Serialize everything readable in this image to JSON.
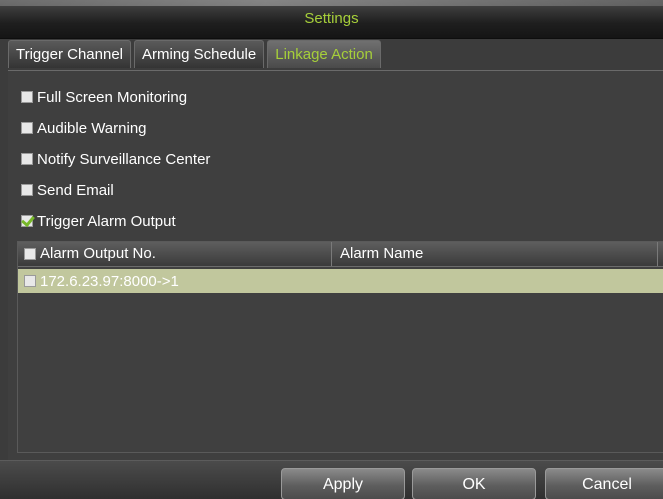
{
  "dialog": {
    "title": "Settings"
  },
  "tabs": [
    {
      "label": "Trigger Channel",
      "active": false
    },
    {
      "label": "Arming Schedule",
      "active": false
    },
    {
      "label": "Linkage Action",
      "active": true
    }
  ],
  "options": [
    {
      "label": "Full Screen Monitoring",
      "checked": false
    },
    {
      "label": "Audible Warning",
      "checked": false
    },
    {
      "label": "Notify Surveillance Center",
      "checked": false
    },
    {
      "label": "Send Email",
      "checked": false
    },
    {
      "label": "Trigger Alarm Output",
      "checked": true
    }
  ],
  "table": {
    "columns": [
      "Alarm Output No.",
      "Alarm Name"
    ],
    "rows": [
      {
        "output": "172.6.23.97:8000->1",
        "name": "",
        "checked": false,
        "selected": true
      }
    ]
  },
  "buttons": {
    "apply": "Apply",
    "ok": "OK",
    "cancel": "Cancel"
  },
  "colors": {
    "accent": "#a6cf3a",
    "row_highlight": "#c1c79d"
  }
}
